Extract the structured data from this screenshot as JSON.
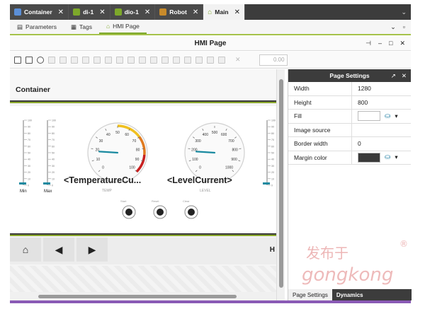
{
  "doc_tabs": [
    {
      "label": "Container",
      "close": "✕",
      "color": "#5b8fd8",
      "active": false
    },
    {
      "label": "di-1",
      "close": "✕",
      "color": "#7da82a",
      "active": false
    },
    {
      "label": "dio-1",
      "close": "✕",
      "color": "#7da82a",
      "active": false
    },
    {
      "label": "Robot",
      "close": "✕",
      "color": "#c88a2a",
      "active": false
    },
    {
      "label": "Main",
      "close": "✕",
      "color": "#7da82a",
      "active": true
    }
  ],
  "sub_tabs": [
    {
      "label": "Parameters"
    },
    {
      "label": "Tags"
    },
    {
      "label": "HMI Page",
      "active": true
    }
  ],
  "title": "HMI Page",
  "zoom_value": "0.00",
  "container_title": "Container",
  "gauges": {
    "temp": {
      "label": "<TemperatureCu...",
      "caption": "TEMP",
      "ticks": [
        "0",
        "10",
        "20",
        "30",
        "40",
        "50",
        "60",
        "70",
        "80",
        "90",
        "100"
      ],
      "value": 18
    },
    "level": {
      "label": "<LevelCurrent>",
      "caption": "LEVEL",
      "ticks": [
        "0",
        "100",
        "200",
        "300",
        "400",
        "500",
        "600",
        "700",
        "800",
        "900",
        "1000"
      ],
      "value": 180
    }
  },
  "bars": {
    "min_label": "Min",
    "max_label": "Max",
    "ticks": [
      "100",
      "90",
      "80",
      "70",
      "60",
      "50",
      "40",
      "30",
      "20",
      "10",
      "0"
    ]
  },
  "knobs": [
    {
      "caption": "Start"
    },
    {
      "caption": "Reset"
    },
    {
      "caption": "Clear"
    }
  ],
  "nav": {
    "home_icon": "⌂",
    "prev_icon": "◀",
    "next_icon": "▶",
    "h_label": "H"
  },
  "panel": {
    "title": "Page Settings",
    "rows": [
      {
        "label": "Width",
        "value": "1280"
      },
      {
        "label": "Height",
        "value": "800"
      },
      {
        "label": "Fill",
        "value": ""
      },
      {
        "label": "Image source",
        "value": ""
      },
      {
        "label": "Border width",
        "value": "0"
      },
      {
        "label": "Margin color",
        "value": ""
      }
    ],
    "tabs": [
      {
        "label": "Page Settings",
        "active": true
      },
      {
        "label": "Dynamics"
      }
    ]
  },
  "colors": {
    "accent": "#8aa82b",
    "dark": "#3c3c3c",
    "gauge_needle": "#1a8aa0",
    "purple": "#8a5ab5"
  },
  "watermark": {
    "line1": "发布于",
    "line2": "gongkong",
    "mark": "®"
  }
}
